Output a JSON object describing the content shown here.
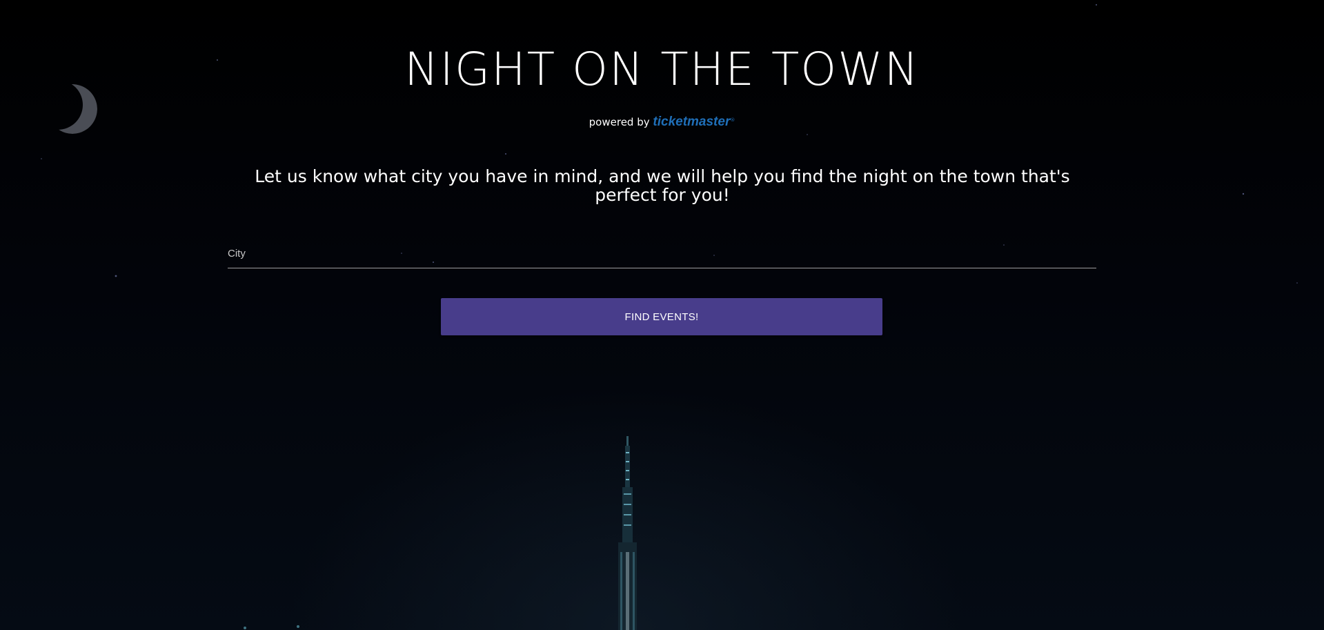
{
  "header": {
    "title": "NIGHT ON THE TOWN",
    "powered_by_text": "powered by",
    "brand_logo_text": "ticketmaster"
  },
  "intro": {
    "tagline": "Let us know what city you have in mind, and we will help you find the night on the town that's perfect for you!"
  },
  "search": {
    "city_placeholder": "City",
    "city_value": ""
  },
  "actions": {
    "find_events_label": "FIND EVENTS!"
  },
  "theme": {
    "background": "#000000",
    "button_color": "#483d8b",
    "brand_color": "#1f6fb8",
    "text_color": "#ffffff"
  },
  "background_image": {
    "depicts": [
      "moon-icon",
      "stars",
      "skyscraper-spire"
    ]
  }
}
